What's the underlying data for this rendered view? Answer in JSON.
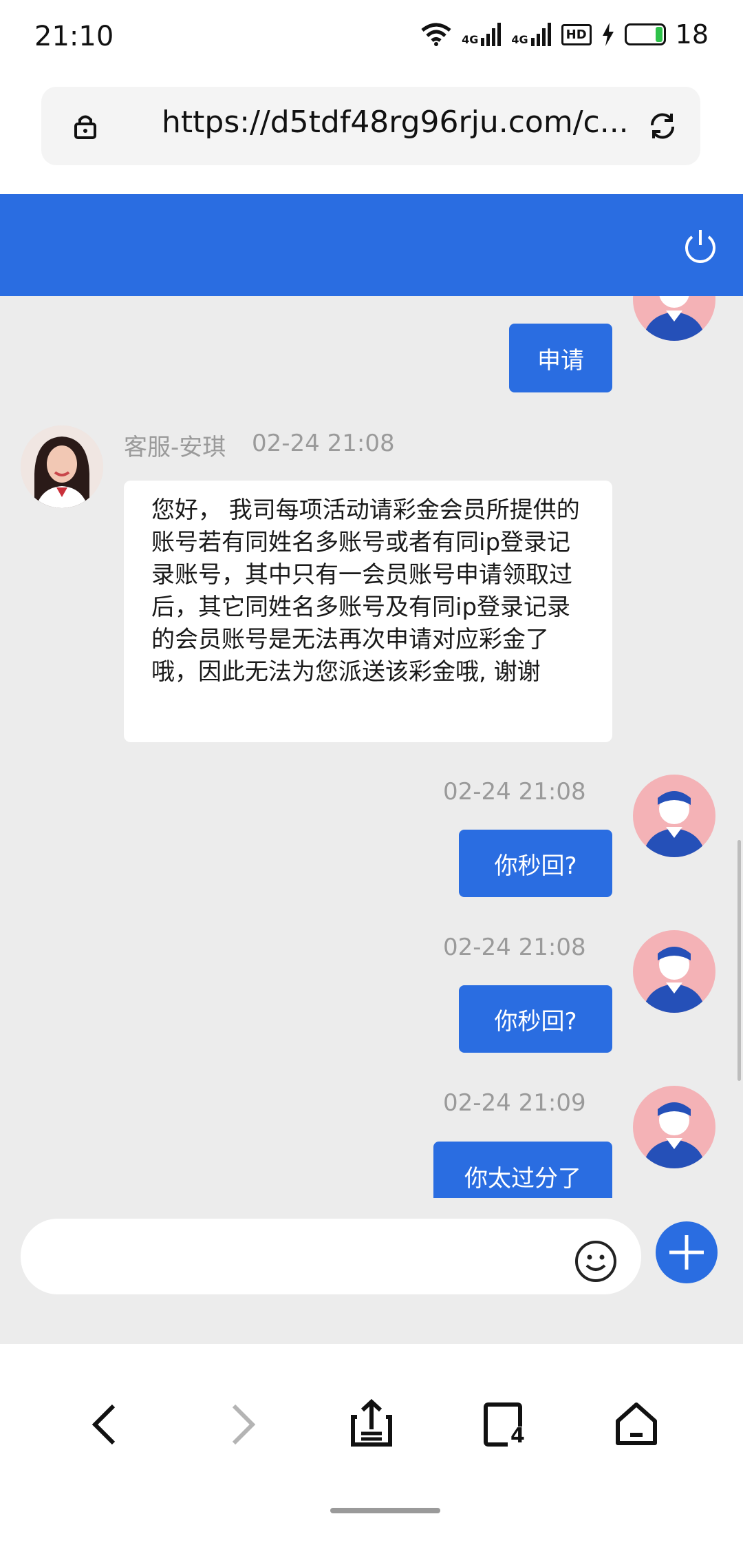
{
  "status": {
    "time": "21:10",
    "battery": "18",
    "net1": "4G",
    "net2": "4G",
    "hd": "HD"
  },
  "browser": {
    "url": "https://d5tdf48rg96rju.com/c..."
  },
  "messages": [
    {
      "from": "user",
      "timestamp": "",
      "text": "申请"
    },
    {
      "from": "agent",
      "name": "客服-安琪",
      "timestamp": "02-24 21:08",
      "text": "您好， 我司每项活动请彩金会员所提供的账号若有同姓名多账号或者有同ip登录记录账号，其中只有一会员账号申请领取过后，其它同姓名多账号及有同ip登录记录的会员账号是无法再次申请对应彩金了哦，因此无法为您派送该彩金哦, 谢谢"
    },
    {
      "from": "user",
      "timestamp": "02-24 21:08",
      "text": "你秒回?"
    },
    {
      "from": "user",
      "timestamp": "02-24 21:08",
      "text": "你秒回?"
    },
    {
      "from": "user",
      "timestamp": "02-24 21:09",
      "text": "你太过分了"
    }
  ],
  "composer": {
    "placeholder": ""
  },
  "colors": {
    "accent": "#2a6de1",
    "background": "#ececec",
    "user_avatar_bg": "#f4b2b6"
  },
  "nav": {
    "tabs_count": "4"
  }
}
